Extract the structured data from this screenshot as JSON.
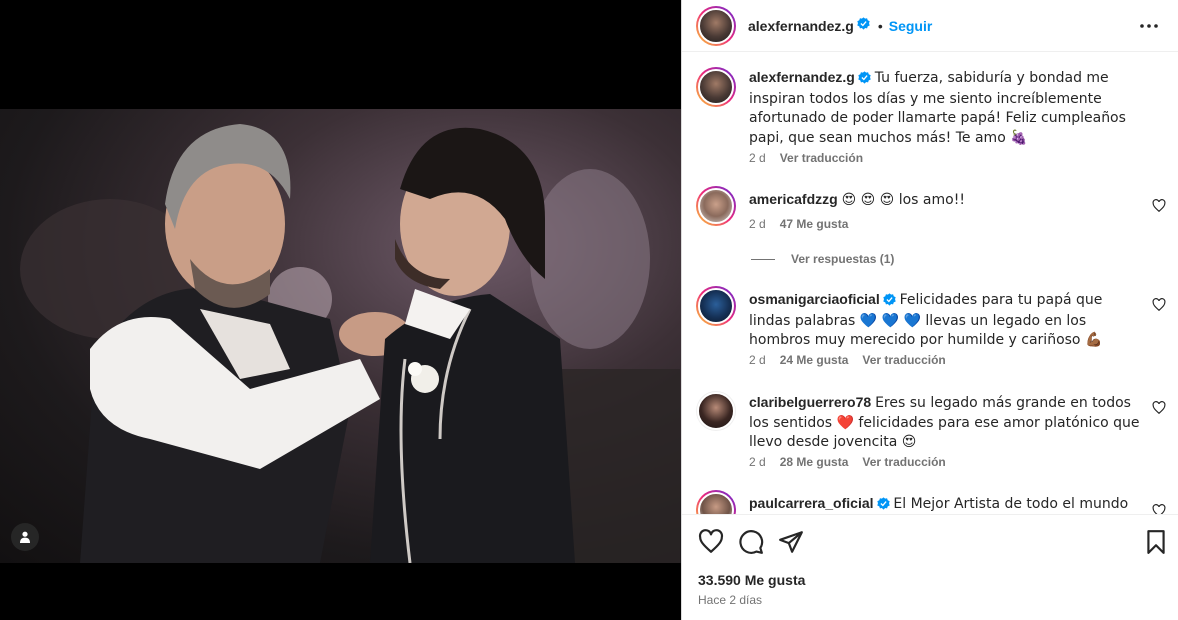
{
  "post": {
    "username": "alexfernandez.g",
    "follow_label": "Seguir",
    "separator": "•",
    "likes": "33.590 Me gusta",
    "posted": "Hace 2 días"
  },
  "caption": {
    "username": "alexfernandez.g",
    "text": "Tu fuerza, sabiduría y bondad me inspiran todos los días y me siento increíblemente afortunado de poder llamarte papá! Feliz cumpleaños papi, que sean muchos más! Te amo 🍇",
    "time": "2 d",
    "translate": "Ver traducción"
  },
  "comments": [
    {
      "username": "americafdzzg",
      "text": "😍 😍 😍  los amo!!",
      "time": "2 d",
      "likes": "47 Me gusta",
      "translate": ""
    },
    {
      "username": "osmanigarciaoficial",
      "text": "Felicidades para tu papá que lindas palabras 💙 💙 💙 llevas un legado en los hombros muy merecido por humilde y cariñoso 💪🏾",
      "time": "2 d",
      "likes": "24 Me gusta",
      "translate": "Ver traducción"
    },
    {
      "username": "claribelguerrero78",
      "text": "Eres su legado más grande en todos los sentidos ❤️  felicidades para ese amor platónico que llevo desde jovencita 😍",
      "time": "2 d",
      "likes": "28 Me gusta",
      "translate": "Ver traducción"
    },
    {
      "username": "paulcarrera_oficial",
      "text": "El Mejor Artista de todo el mundo ❤️",
      "time": "",
      "likes": "",
      "translate": ""
    }
  ],
  "replies_label": "Ver respuestas (1)",
  "icons": {
    "more": "more-horizontal-icon",
    "like": "heart-icon",
    "comment": "comment-bubble-icon",
    "share": "paper-plane-icon",
    "save": "bookmark-icon",
    "tag": "person-tag-icon",
    "verified": "verified-badge-icon"
  },
  "colors": {
    "accent": "#0095f6",
    "text": "#262626",
    "muted": "#737373",
    "media_bg": "#000000"
  }
}
